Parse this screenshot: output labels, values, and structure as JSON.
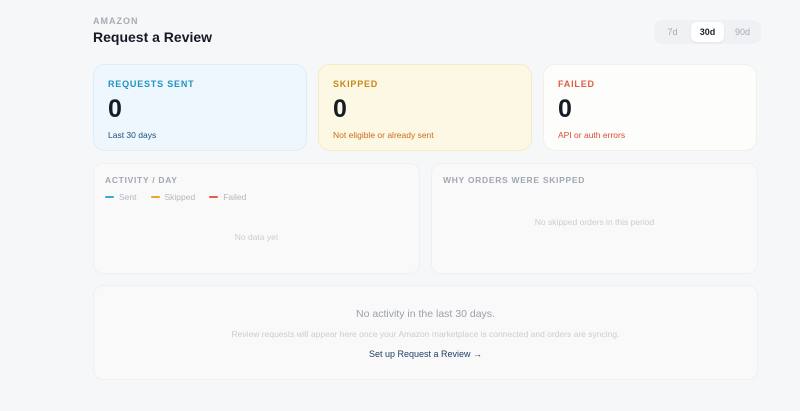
{
  "header": {
    "eyebrow": "AMAZON",
    "title": "Request a Review"
  },
  "range": {
    "options": [
      "7d",
      "30d",
      "90d"
    ],
    "selected": "30d"
  },
  "kpis": {
    "sent": {
      "label": "REQUESTS SENT",
      "value": "0",
      "sub": "Last 30 days"
    },
    "skipped": {
      "label": "SKIPPED",
      "value": "0",
      "sub": "Not eligible or already sent"
    },
    "failed": {
      "label": "FAILED",
      "value": "0",
      "sub": "API or auth errors"
    }
  },
  "activity": {
    "title": "ACTIVITY / DAY",
    "legend": [
      {
        "label": "Sent",
        "color": "#3aa6d3"
      },
      {
        "label": "Skipped",
        "color": "#e7a92a"
      },
      {
        "label": "Failed",
        "color": "#e85b45"
      }
    ],
    "empty": "No data yet"
  },
  "skip_reasons": {
    "title": "WHY ORDERS WERE SKIPPED",
    "empty": "No skipped orders in this period"
  },
  "empty_state": {
    "headline": "No activity in the last 30 days.",
    "description": "Review requests will appear here once your Amazon marketplace is connected and orders are syncing.",
    "cta": "Set up Request a Review →"
  }
}
